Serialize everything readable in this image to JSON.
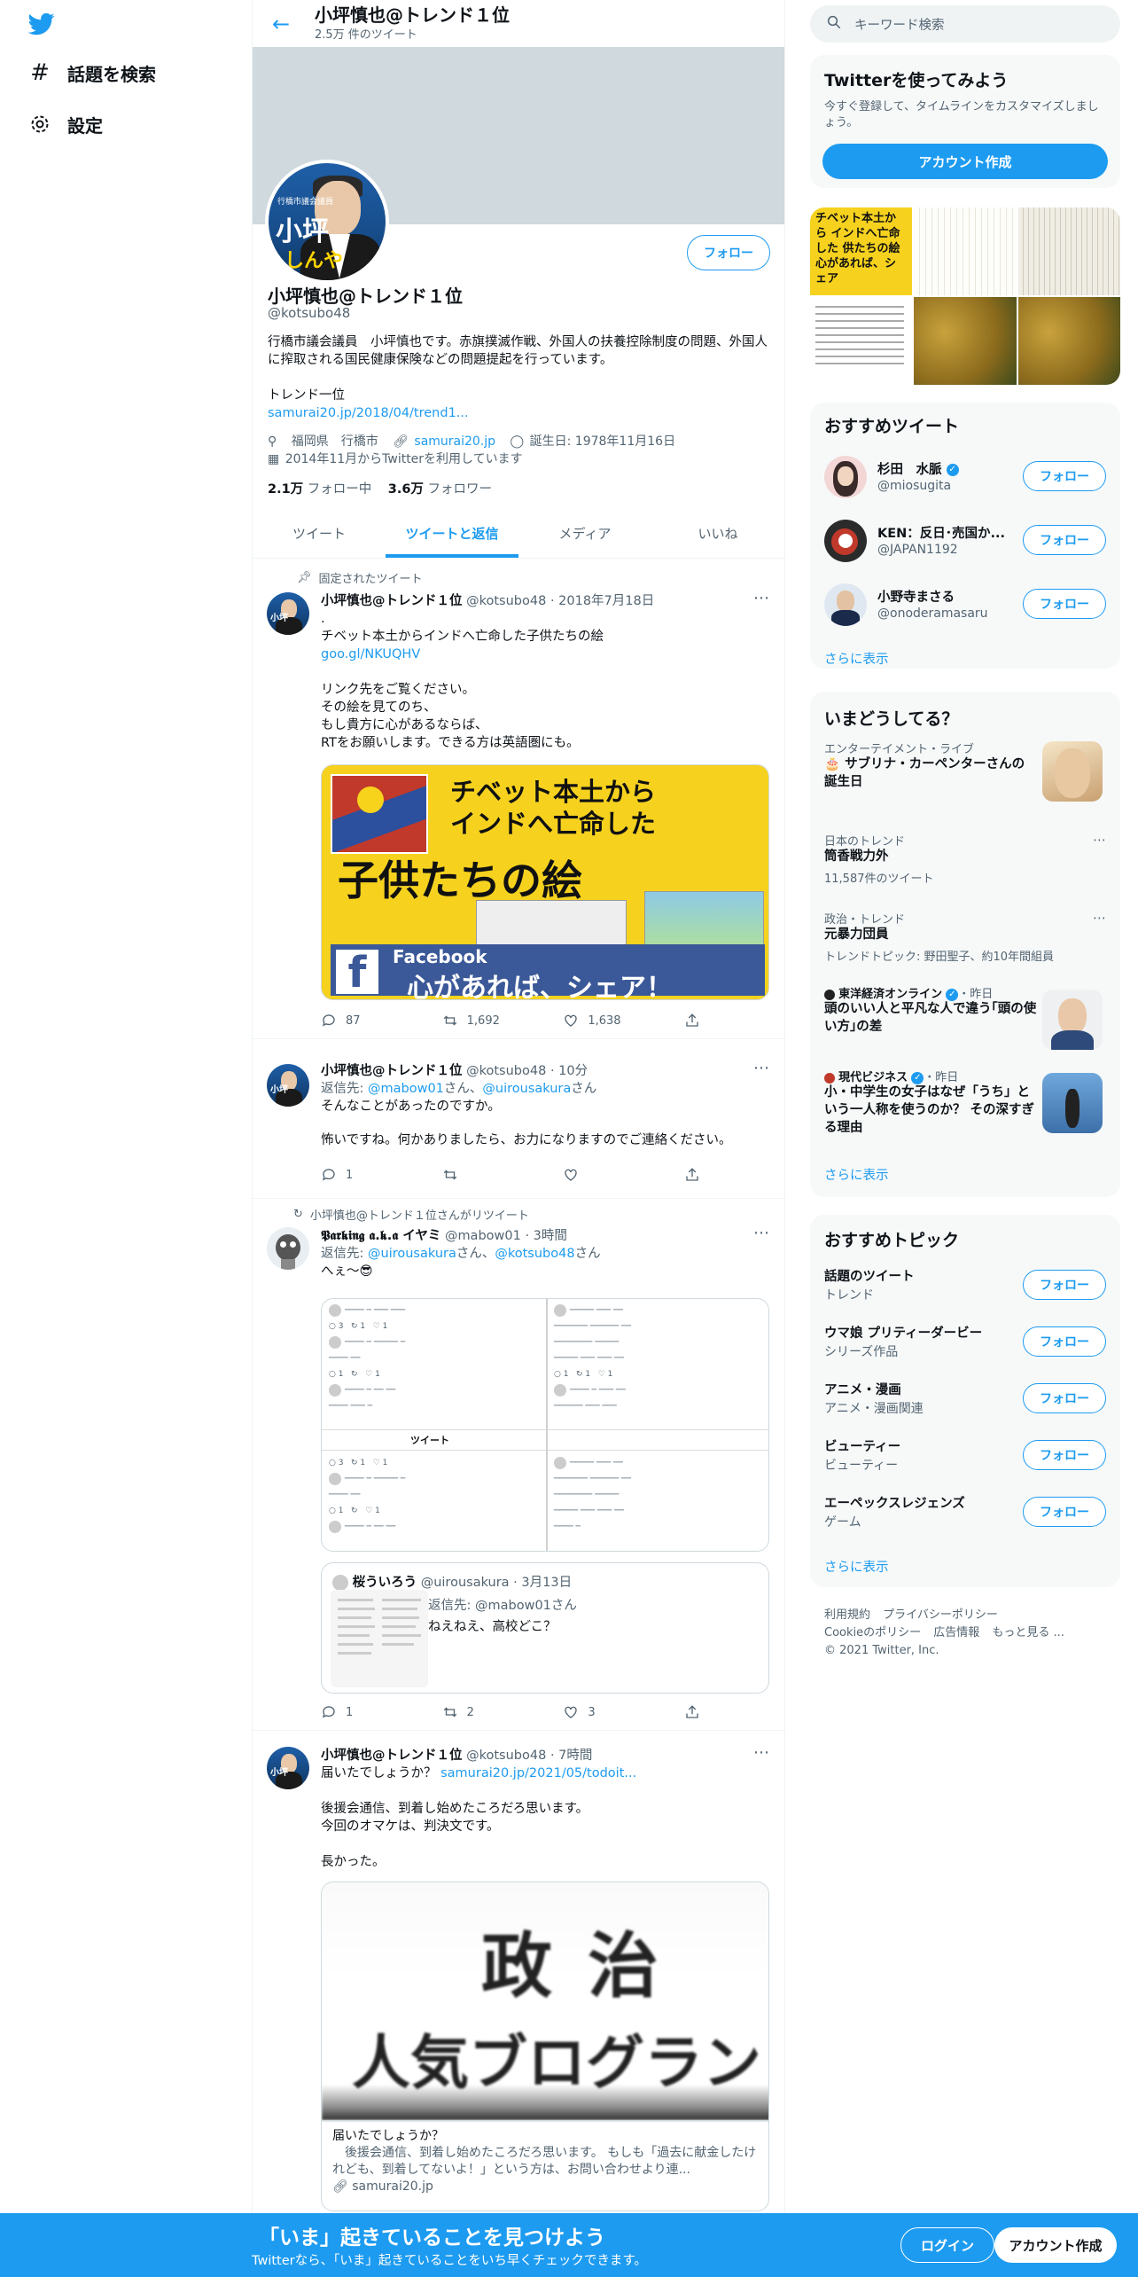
{
  "nav": {
    "explore": "話題を検索",
    "settings": "設定"
  },
  "header": {
    "title": "小坪慎也@トレンド１位",
    "tweet_count": "2.5万 件のツイート"
  },
  "profile": {
    "avatar_text_top": "行橋市議会議員",
    "avatar_text_name": "小坪",
    "avatar_text_kana": "しんや",
    "follow": "フォロー",
    "name": "小坪慎也@トレンド１位",
    "handle": "@kotsubo48",
    "bio": "行橋市議会議員　小坪慎也です。赤旗撲滅作戦、外国人の扶養控除制度の問題、外国人に搾取される国民健康保険などの問題提起を行っています。",
    "bio_line2": "トレンド一位",
    "bio_link": "samurai20.jp/2018/04/trend1...",
    "location": "福岡県　行橋市",
    "website": "samurai20.jp",
    "birthday": "誕生日: 1978年11月16日",
    "joined": "2014年11月からTwitterを利用しています",
    "following_count": "2.1万",
    "following_label": "フォロー中",
    "followers_count": "3.6万",
    "followers_label": "フォロワー"
  },
  "tabs": [
    {
      "label": "ツイート"
    },
    {
      "label": "ツイートと返信"
    },
    {
      "label": "メディア"
    },
    {
      "label": "いいね"
    }
  ],
  "tweets": [
    {
      "context": "固定されたツイート",
      "name": "小坪慎也@トレンド１位",
      "handle": "@kotsubo48",
      "time": "2018年7月18日",
      "body": [
        ".",
        "チベット本土からインドへ亡命した子供たちの絵"
      ],
      "link": "goo.gl/NKUQHV",
      "body2": [
        "リンク先をご覧ください。",
        "その絵を見てのち、",
        "もし貴方に心があるならば、",
        "RTをお願いします。できる方は英語圏にも。"
      ],
      "media_title1": "チベット本土から",
      "media_title2": "インドへ亡命した",
      "media_title3": "子供たちの絵",
      "media_fb": "Facebook",
      "media_share": "心があれば、シェア！",
      "replies": "87",
      "retweets": "1,692",
      "likes": "1,638"
    },
    {
      "name": "小坪慎也@トレンド１位",
      "handle": "@kotsubo48",
      "time": "10分",
      "reply_prefix": "返信先:",
      "reply_to1": "@mabow01",
      "reply_mid": "さん、",
      "reply_to2": "@uirousakura",
      "reply_suffix": "さん",
      "body": [
        "そんなことがあったのですか。",
        "怖いですね。何かありましたら、お力になりますのでご連絡ください。"
      ],
      "replies": "1",
      "retweets": "",
      "likes": ""
    },
    {
      "context": "小坪慎也@トレンド１位さんがリツイート",
      "name": "𝕻𝖆𝖗𝖐𝖎𝖓𝖌 𝖆.𝖐.𝖆 イヤミ",
      "handle": "@mabow01",
      "time": "3時間",
      "reply_prefix": "返信先:",
      "reply_to1": "@uirousakura",
      "reply_mid": "さん、",
      "reply_to2": "@kotsubo48",
      "reply_suffix": "さん",
      "body": [
        "へぇ〜😎"
      ],
      "shot_bar": "ツイート",
      "quote_name": "桜ういろう",
      "quote_handle": "@uirousakura",
      "quote_time": "3月13日",
      "quote_reply": "返信先: @mabow01さん",
      "quote_text": "ねえねえ、高校どこ？",
      "replies": "1",
      "retweets": "2",
      "likes": "3"
    },
    {
      "name": "小坪慎也@トレンド１位",
      "handle": "@kotsubo48",
      "time": "7時間",
      "body_first": "届いたでしょうか？",
      "link": "samurai20.jp/2021/05/todoit...",
      "body": [
        "後援会通信、到着し始めたころだろ思います。",
        "今回のオマケは、判決文です。",
        "長かった。"
      ],
      "media_text1": "政治",
      "media_text2": "人気ブログラン",
      "card_title": "届いたでしょうか？",
      "card_desc": "　後援会通信、到着し始めたころだろ思います。 もしも「過去に献金したけれども、到着してないよ！」という方は、お問い合わせより連...",
      "card_domain": "samurai20.jp"
    }
  ],
  "right": {
    "search_placeholder": "キーワード検索",
    "join_title": "Twitterを使ってみよう",
    "join_desc": "今すぐ登録して、タイムラインをカスタマイズしましょう。",
    "join_button": "アカウント作成",
    "photo_caption": "チベット本土から インドへ亡命した 供たちの絵 心があれば、シェア",
    "rec_title": "おすすめツイート",
    "recs": [
      {
        "name": "杉田　水脈",
        "handle": "@miosugita",
        "verified": "✓",
        "follow": "フォロー"
      },
      {
        "name": "KEN：反日･売国か...",
        "handle": "@JAPAN1192",
        "verified": "",
        "follow": "フォロー"
      },
      {
        "name": "小野寺まさる",
        "handle": "@onoderamasaru",
        "verified": "",
        "follow": "フォロー"
      }
    ],
    "rec_more": "さらに表示",
    "trend_title": "いまどうしてる？",
    "trends": [
      {
        "cat": "エンターテイメント・ライブ",
        "title": "🎂 サブリナ・カーペンターさんの誕生日",
        "sub": ""
      },
      {
        "cat": "日本のトレンド",
        "title": "筒香戦力外",
        "sub": "11,587件のツイート"
      },
      {
        "cat": "政治・トレンド",
        "title": "元暴力団員",
        "sub": "トレンドトピック: 野田聖子、約10年間組員"
      },
      {
        "cat": "東洋経済オンライン",
        "time": "・昨日",
        "title": "頭のいい人と平凡な人で違う｢頭の使い方｣の差",
        "sub": ""
      },
      {
        "cat": "現代ビジネス",
        "time": "・昨日",
        "title": "小・中学生の女子はなぜ「うち」という一人称を使うのか？ その深すぎる理由",
        "sub": ""
      }
    ],
    "trend_more": "さらに表示",
    "topic_title": "おすすめトピック",
    "topics": [
      {
        "title": "話題のツイート",
        "sub": "トレンド",
        "follow": "フォロー"
      },
      {
        "title": "ウマ娘 プリティーダービー",
        "sub": "シリーズ作品",
        "follow": "フォロー"
      },
      {
        "title": "アニメ・漫画",
        "sub": "アニメ・漫画関連",
        "follow": "フォロー"
      },
      {
        "title": "ビューティー",
        "sub": "ビューティー",
        "follow": "フォロー"
      },
      {
        "title": "エーペックスレジェンズ",
        "sub": "ゲーム",
        "follow": "フォロー"
      }
    ],
    "topic_more": "さらに表示",
    "footer": [
      "利用規約",
      "プライバシーポリシー",
      "Cookieのポリシー",
      "広告情報",
      "もっと見る ...",
      "© 2021 Twitter, Inc."
    ]
  },
  "bottom": {
    "headline": "「いま」起きていることを見つけよう",
    "sub": "Twitterなら、「いま」起きていることをいち早くチェックできます。",
    "login": "ログイン",
    "signup": "アカウント作成"
  },
  "colors": {
    "accent": "#1d9bf0",
    "text": "#0f1419",
    "muted": "#536471"
  }
}
